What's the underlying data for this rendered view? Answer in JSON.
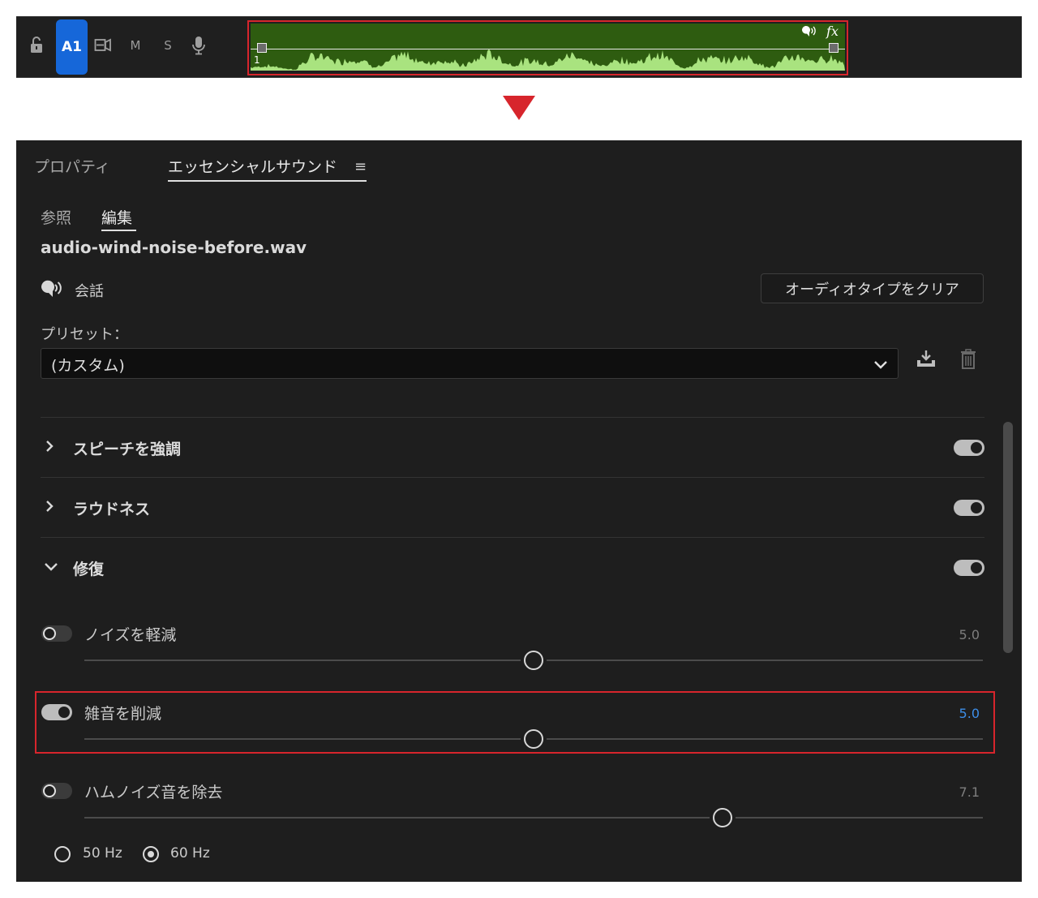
{
  "timeline": {
    "track_name": "A1",
    "mute_label": "M",
    "solo_label": "S",
    "clip_number": "1",
    "clip_fx_label": "fx",
    "clip_color": "#2e5c10",
    "waveform_color": "#a9e37f",
    "selected_track_color": "#1667d9",
    "icons": [
      "lock-icon",
      "sync-lock-icon",
      "microphone-icon",
      "speech-bubble-icon"
    ]
  },
  "panel": {
    "tabs": [
      {
        "label": "プロパティ",
        "active": false
      },
      {
        "label": "エッセンシャルサウンド",
        "active": true
      }
    ],
    "menu_icon": "≡",
    "subtabs": [
      {
        "label": "参照",
        "active": false
      },
      {
        "label": "編集",
        "active": true
      }
    ],
    "file_name": "audio-wind-noise-before.wav",
    "audio_type": "会話",
    "clear_button": "オーディオタイプをクリア",
    "preset_label": "プリセット：",
    "preset_value": "(カスタム)",
    "sections": [
      {
        "title": "スピーチを強調",
        "expanded": false,
        "enabled": true
      },
      {
        "title": "ラウドネス",
        "expanded": false,
        "enabled": true
      },
      {
        "title": "修復",
        "expanded": true,
        "enabled": true
      }
    ],
    "repair_effects": [
      {
        "label": "ノイズを軽減",
        "enabled": false,
        "value": "5.0",
        "level": 0.5
      },
      {
        "label": "雑音を削減",
        "enabled": true,
        "value": "5.0",
        "level": 0.5
      },
      {
        "label": "ハムノイズ音を除去",
        "enabled": false,
        "value": "7.1",
        "level": 0.71
      }
    ],
    "hum_frequency": {
      "options": [
        "50 Hz",
        "60 Hz"
      ],
      "selected": "60 Hz"
    },
    "accent_color": "#3d8ee8",
    "highlight_color": "#d7252c"
  }
}
